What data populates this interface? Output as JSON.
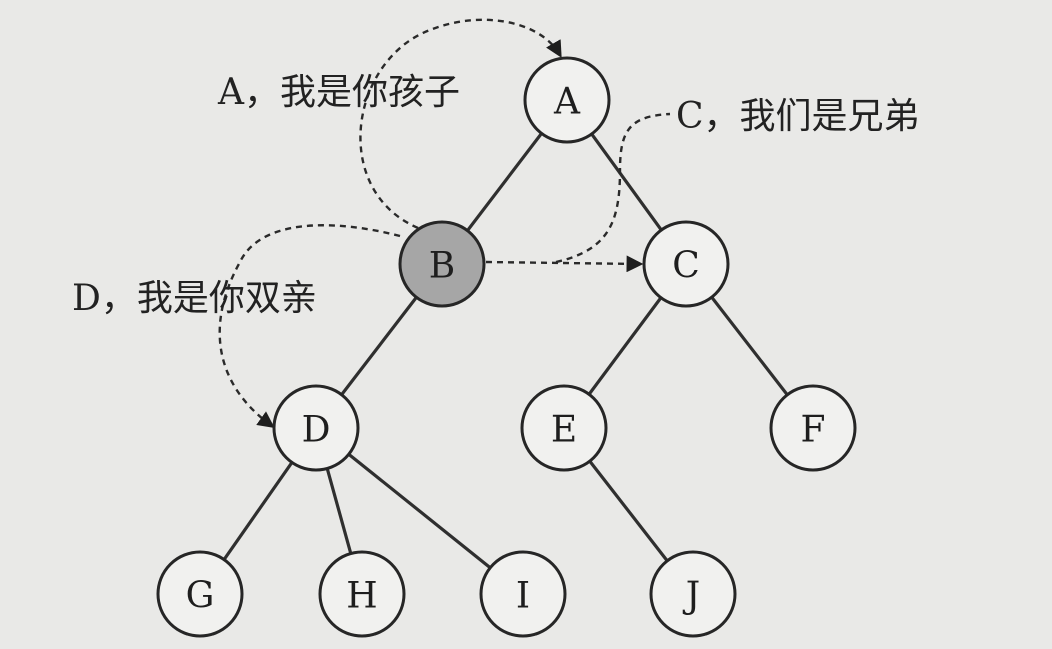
{
  "nodes": [
    {
      "id": "A",
      "label": "A",
      "highlight": false
    },
    {
      "id": "B",
      "label": "B",
      "highlight": true
    },
    {
      "id": "C",
      "label": "C",
      "highlight": false
    },
    {
      "id": "D",
      "label": "D",
      "highlight": false
    },
    {
      "id": "E",
      "label": "E",
      "highlight": false
    },
    {
      "id": "F",
      "label": "F",
      "highlight": false
    },
    {
      "id": "G",
      "label": "G",
      "highlight": false
    },
    {
      "id": "H",
      "label": "H",
      "highlight": false
    },
    {
      "id": "I",
      "label": "I",
      "highlight": false
    },
    {
      "id": "J",
      "label": "J",
      "highlight": false
    }
  ],
  "edges": [
    [
      "A",
      "B"
    ],
    [
      "A",
      "C"
    ],
    [
      "B",
      "D"
    ],
    [
      "C",
      "E"
    ],
    [
      "C",
      "F"
    ],
    [
      "D",
      "G"
    ],
    [
      "D",
      "H"
    ],
    [
      "D",
      "I"
    ],
    [
      "E",
      "J"
    ]
  ],
  "annotations": {
    "to_parent": "A，我是你孩子",
    "to_sibling": "C，我们是兄弟",
    "to_child": "D，我是你双亲"
  },
  "colors": {
    "background": "#e9e9e7",
    "highlight_node": "#a6a6a6"
  }
}
